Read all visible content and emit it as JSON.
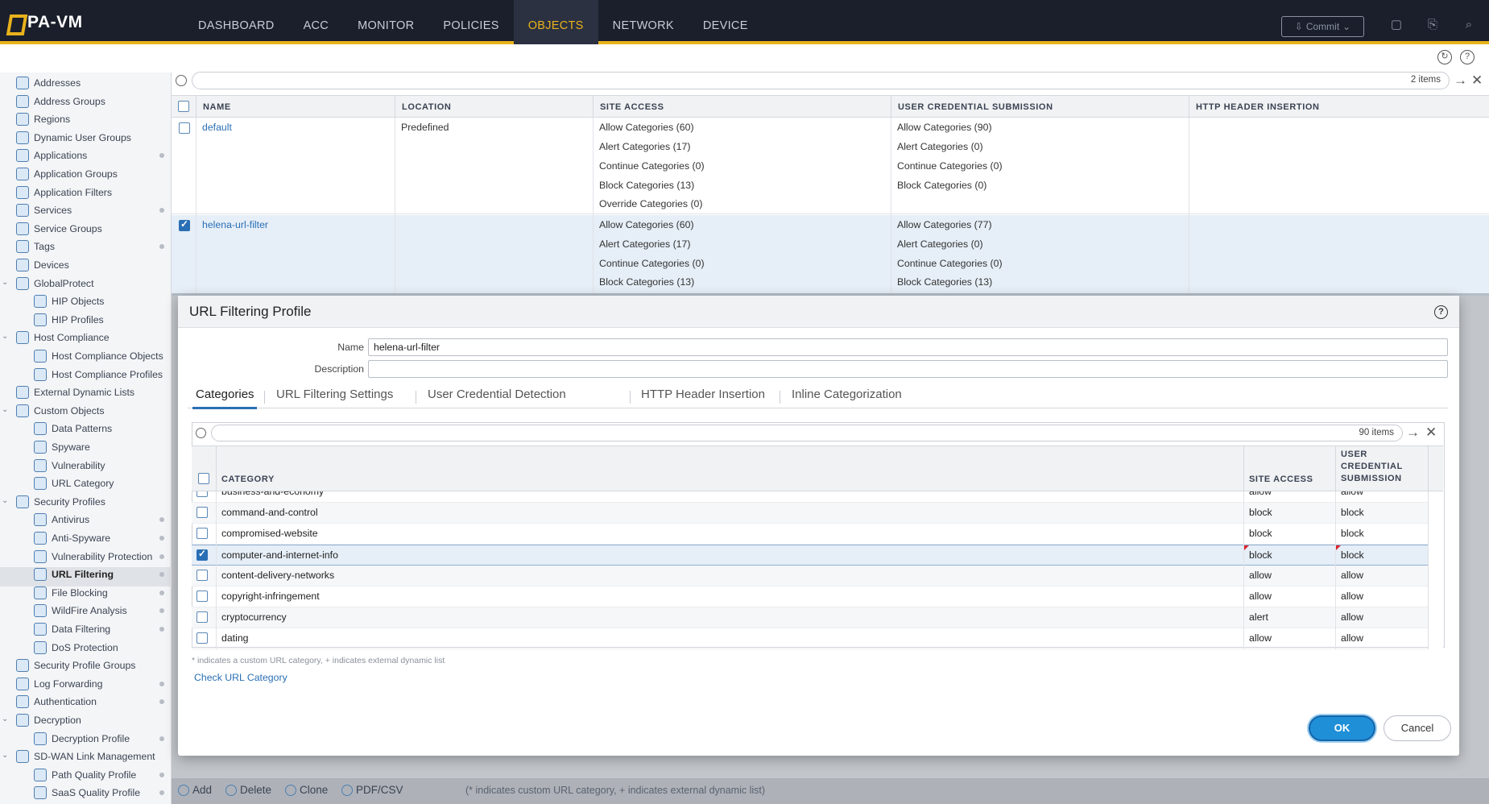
{
  "app": {
    "logo_text": "PA-VM"
  },
  "nav": {
    "items": [
      "DASHBOARD",
      "ACC",
      "MONITOR",
      "POLICIES",
      "OBJECTS",
      "NETWORK",
      "DEVICE"
    ],
    "active": "OBJECTS"
  },
  "toolbar": {
    "commit_label": "Commit"
  },
  "sidebar": {
    "items": [
      "Addresses",
      "Address Groups",
      "Regions",
      "Dynamic User Groups",
      "Applications",
      "Application Groups",
      "Application Filters",
      "Services",
      "Service Groups",
      "Tags",
      "Devices",
      "GlobalProtect",
      "HIP Objects",
      "HIP Profiles",
      "Host Compliance",
      "Host Compliance Objects",
      "Host Compliance Profiles",
      "External Dynamic Lists",
      "Custom Objects",
      "Data Patterns",
      "Spyware",
      "Vulnerability",
      "URL Category",
      "Security Profiles",
      "Antivirus",
      "Anti-Spyware",
      "Vulnerability Protection",
      "URL Filtering",
      "File Blocking",
      "WildFire Analysis",
      "Data Filtering",
      "DoS Protection",
      "Security Profile Groups",
      "Log Forwarding",
      "Authentication",
      "Decryption",
      "Decryption Profile",
      "SD-WAN Link Management",
      "Path Quality Profile",
      "SaaS Quality Profile"
    ],
    "active": "URL Filtering"
  },
  "main_search": {
    "count": "2 items"
  },
  "main_grid": {
    "headers": [
      "NAME",
      "LOCATION",
      "SITE ACCESS",
      "USER CREDENTIAL SUBMISSION",
      "HTTP HEADER INSERTION"
    ],
    "rows": [
      {
        "name": "default",
        "location": "Predefined",
        "site_access": [
          "Allow Categories (60)",
          "Alert Categories (17)",
          "Continue Categories (0)",
          "Block Categories (13)",
          "Override Categories (0)"
        ],
        "user_cred": [
          "Allow Categories (90)",
          "Alert Categories (0)",
          "Continue Categories (0)",
          "Block Categories (0)"
        ]
      },
      {
        "name": "helena-url-filter",
        "location": "",
        "site_access": [
          "Allow Categories (60)",
          "Alert Categories (17)",
          "Continue Categories (0)",
          "Block Categories (13)"
        ],
        "user_cred": [
          "Allow Categories (77)",
          "Alert Categories (0)",
          "Continue Categories (0)",
          "Block Categories (13)"
        ]
      }
    ]
  },
  "bottom_bar": {
    "add": "Add",
    "delete": "Delete",
    "clone": "Clone",
    "pdf": "PDF/CSV",
    "note": "(* indicates custom URL category, + indicates external dynamic list)"
  },
  "dialog": {
    "title": "URL Filtering Profile",
    "name_label": "Name",
    "name_value": "helena-url-filter",
    "description_label": "Description",
    "description_value": "",
    "tabs": [
      "Categories",
      "URL Filtering Settings",
      "User Credential Detection",
      "HTTP Header Insertion",
      "Inline Categorization"
    ],
    "active_tab": "Categories",
    "search_count": "90 items",
    "headers": {
      "category": "CATEGORY",
      "site_access": "SITE ACCESS",
      "user_cred_1": "USER",
      "user_cred_2": "CREDENTIAL",
      "user_cred_3": "SUBMISSION"
    },
    "rows": [
      {
        "category": "business-and-economy",
        "site": "allow",
        "cred": "allow"
      },
      {
        "category": "command-and-control",
        "site": "block",
        "cred": "block"
      },
      {
        "category": "compromised-website",
        "site": "block",
        "cred": "block"
      },
      {
        "category": "computer-and-internet-info",
        "site": "block",
        "cred": "block",
        "selected": true
      },
      {
        "category": "content-delivery-networks",
        "site": "allow",
        "cred": "allow"
      },
      {
        "category": "copyright-infringement",
        "site": "allow",
        "cred": "allow"
      },
      {
        "category": "cryptocurrency",
        "site": "alert",
        "cred": "allow"
      },
      {
        "category": "dating",
        "site": "allow",
        "cred": "allow"
      }
    ],
    "footnote": "* indicates a custom URL category, + indicates external dynamic list",
    "check_link": "Check URL Category",
    "ok": "OK",
    "cancel": "Cancel"
  },
  "colors": {
    "accent": "#e8b21c",
    "link": "#2a6fb5",
    "topbar": "#1a1f2b",
    "ok": "#1f8fd8",
    "modified_flag": "#d9232d"
  }
}
